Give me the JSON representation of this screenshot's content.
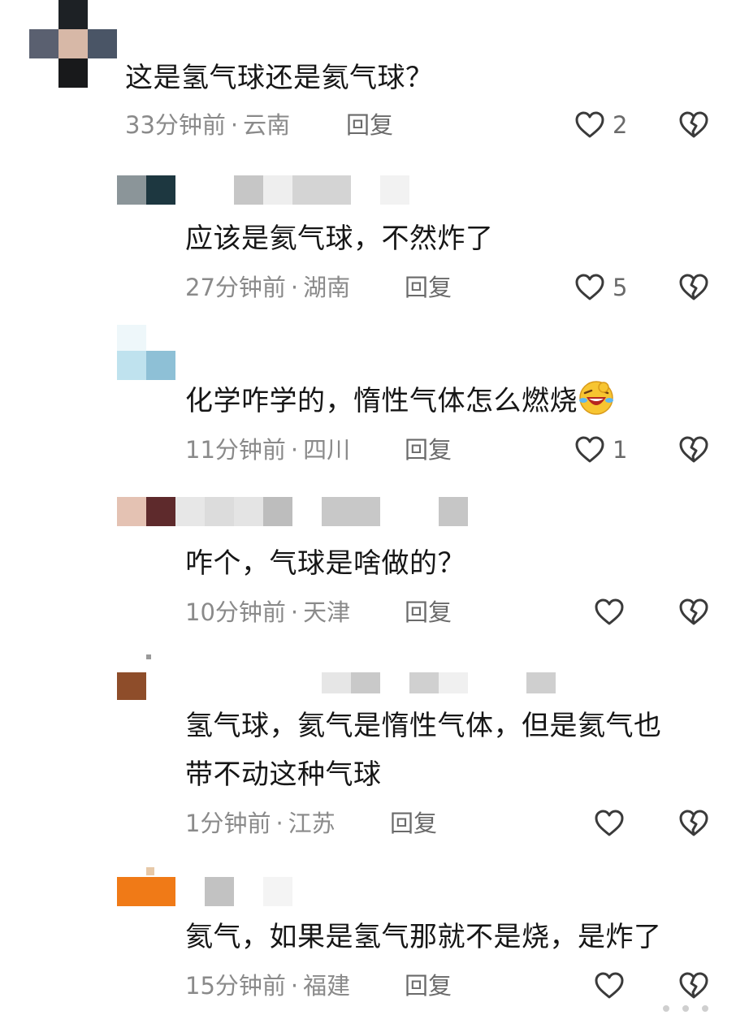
{
  "comments": [
    {
      "text": "这是氢气球还是氦气球？",
      "time": "33分钟前",
      "location": "云南",
      "reply": "回复",
      "likes": "2"
    },
    {
      "text": "应该是氦气球，不然炸了",
      "time": "27分钟前",
      "location": "湖南",
      "reply": "回复",
      "likes": "5"
    },
    {
      "text": "化学咋学的，惰性气体怎么燃烧",
      "time": "11分钟前",
      "location": "四川",
      "reply": "回复",
      "likes": "1"
    },
    {
      "text": "咋个，气球是啥做的？",
      "time": "10分钟前",
      "location": "天津",
      "reply": "回复",
      "likes": ""
    },
    {
      "text_line1": "氢气球，氦气是惰性气体，但是氦气也",
      "text_line2": "带不动这种气球",
      "time": "1分钟前",
      "location": "江苏",
      "reply": "回复",
      "likes": ""
    },
    {
      "text": "氦气，如果是氢气那就不是烧，是炸了",
      "time": "15分钟前",
      "location": "福建",
      "reply": "回复",
      "likes": ""
    }
  ],
  "separator": "·",
  "icons": {
    "like": "heart-outline-icon",
    "dislike": "broken-heart-icon",
    "emoji": "laughing-crying-emoji"
  },
  "colors": {
    "text": "#161616",
    "meta": "#8a8a8a",
    "icon": "#3a3a3a"
  }
}
